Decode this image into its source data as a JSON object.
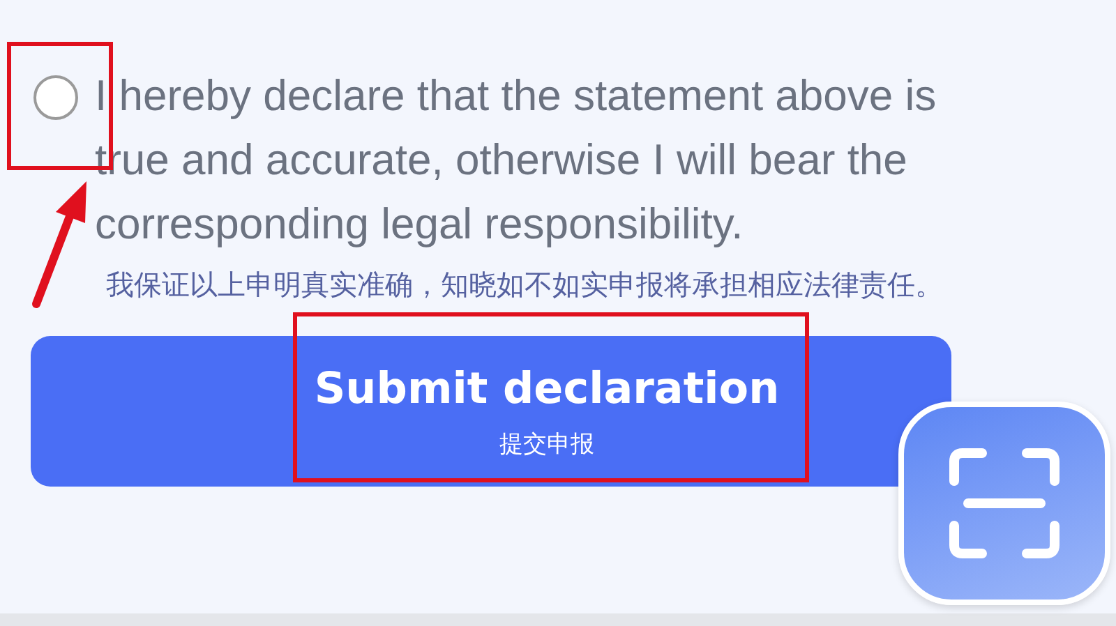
{
  "declaration": {
    "checked": false,
    "highlighted": true,
    "arrow": true,
    "text": "I hereby declare that the statement above is true and accurate, otherwise I will bear the corresponding legal responsibility.",
    "note": "我保证以上申明真实准确，知晓如不如实申报将承担相应法律责任。"
  },
  "submit": {
    "label": "Submit declaration",
    "sublabel": "提交申报",
    "highlighted": true
  },
  "scan_button": {
    "kind": "scan"
  }
}
